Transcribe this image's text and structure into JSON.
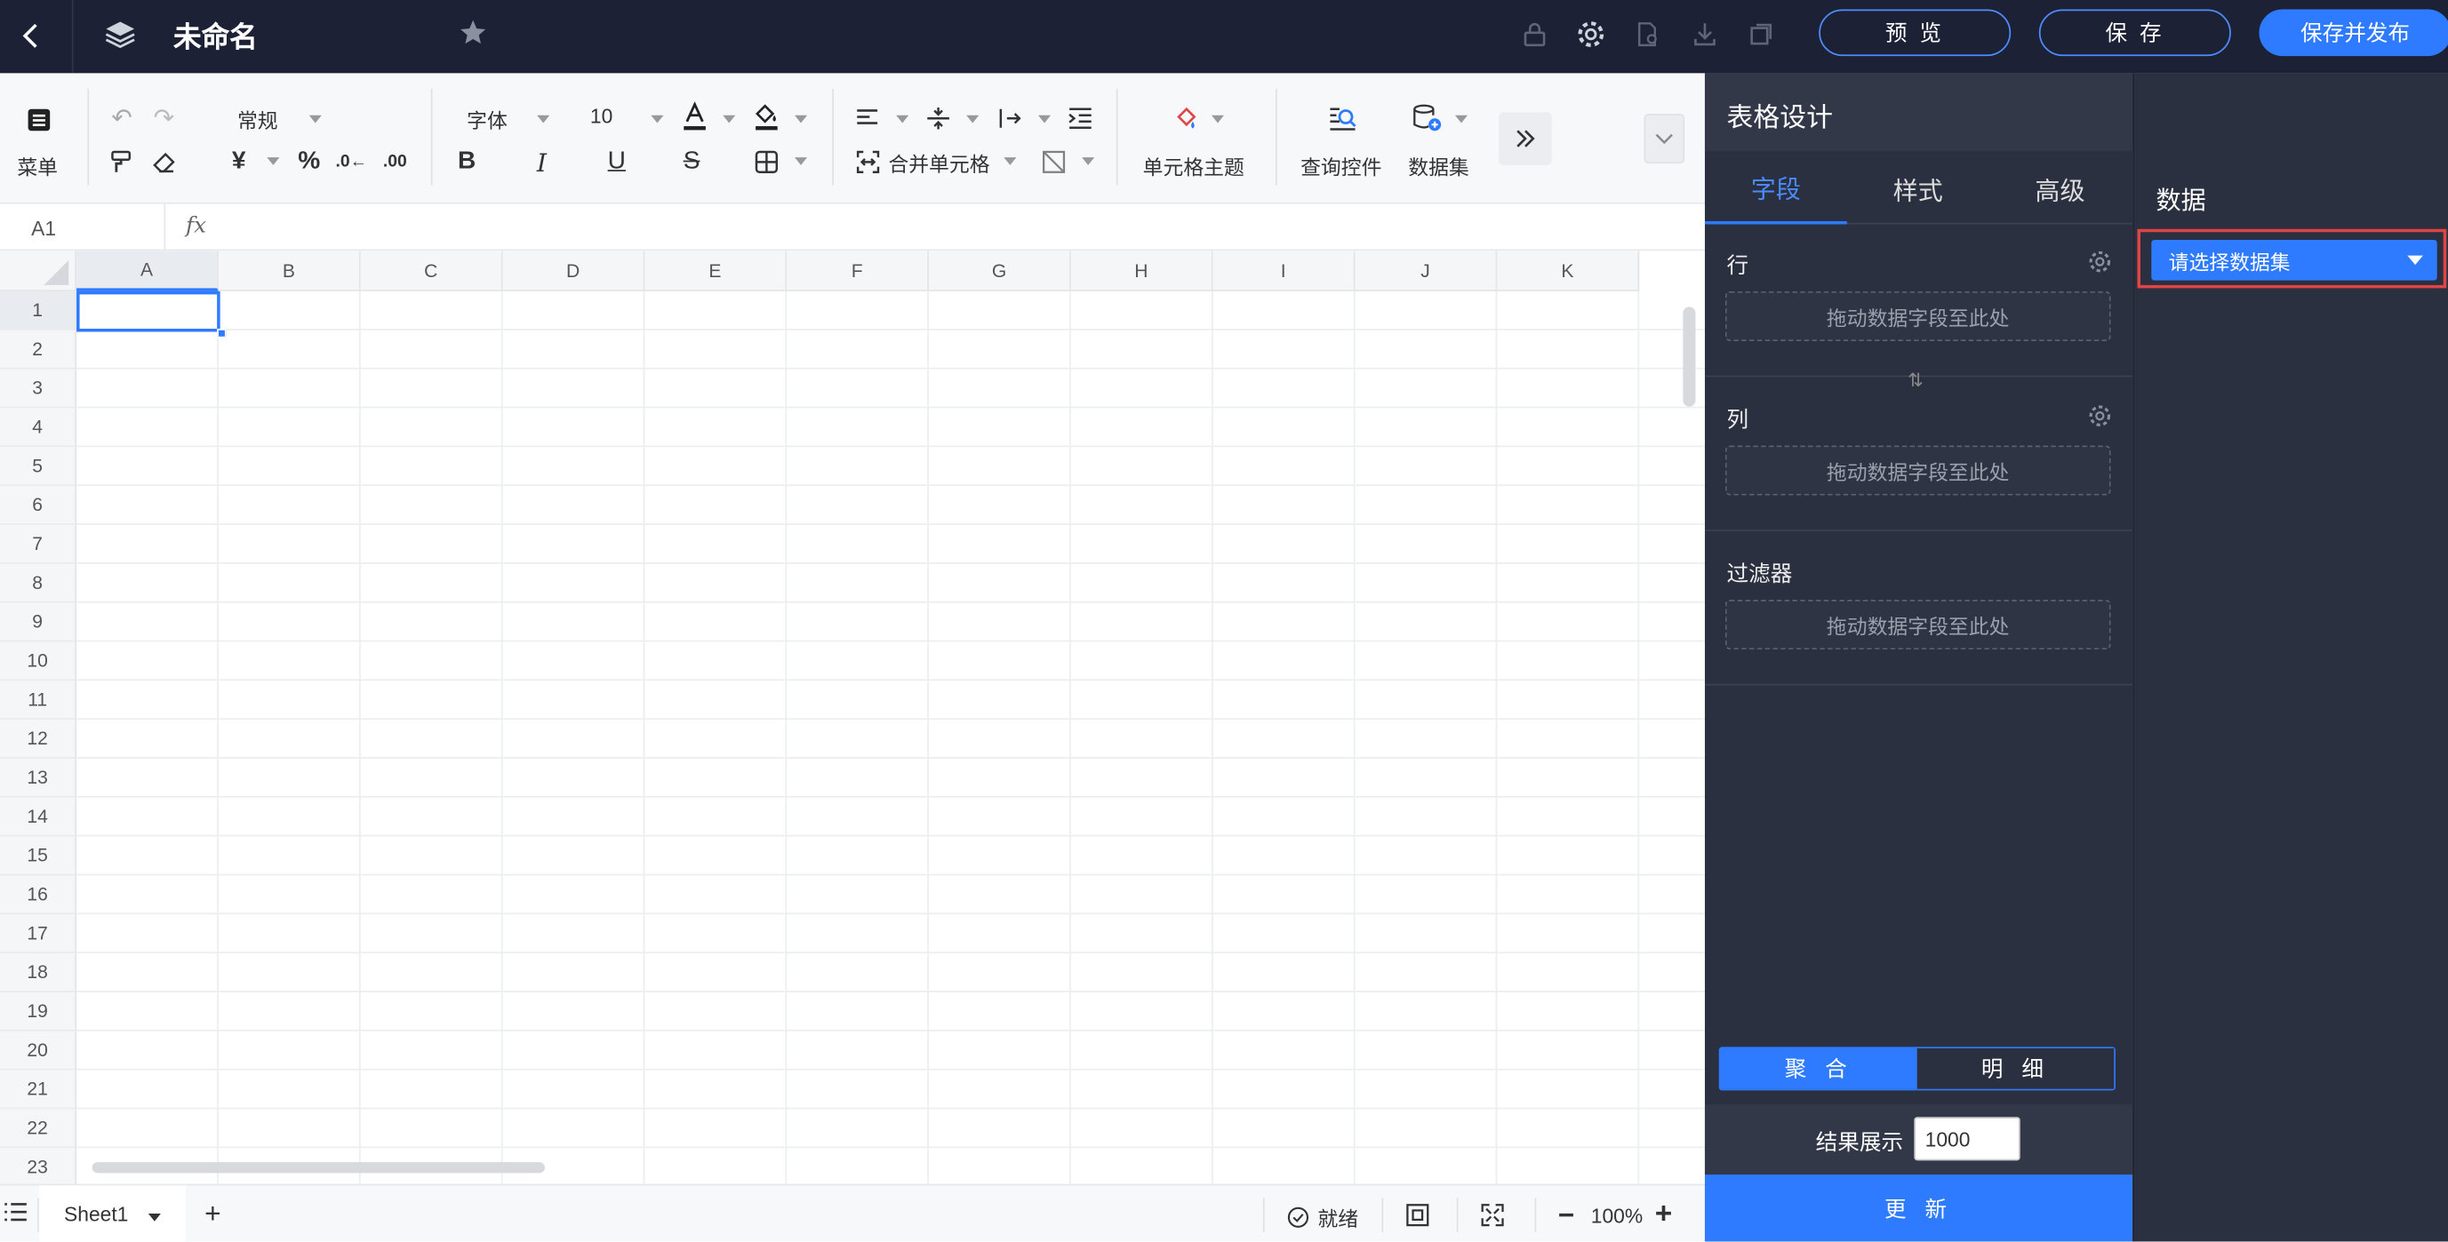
{
  "topbar": {
    "title": "未命名",
    "preview_label": "预 览",
    "save_label": "保 存",
    "save_publish_label": "保存并发布"
  },
  "toolbar": {
    "menu_label": "菜单",
    "number_format": "常规",
    "font_family": "字体",
    "font_size": "10",
    "merge_label": "合并单元格",
    "cell_theme_label": "单元格主题",
    "query_control_label": "查询控件",
    "dataset_label": "数据集"
  },
  "formula_bar": {
    "cell_ref": "A1",
    "fx_label": "fx"
  },
  "sheet": {
    "columns": [
      "A",
      "B",
      "C",
      "D",
      "E",
      "F",
      "G",
      "H",
      "I",
      "J",
      "K"
    ],
    "rows": [
      "1",
      "2",
      "3",
      "4",
      "5",
      "6",
      "7",
      "8",
      "9",
      "10",
      "11",
      "12",
      "13",
      "14",
      "15",
      "16",
      "17",
      "18",
      "19",
      "20",
      "21",
      "22",
      "23"
    ]
  },
  "status_bar": {
    "sheet_tab": "Sheet1",
    "add_label": "+",
    "status_text": "就绪",
    "zoom": "100%"
  },
  "design_panel": {
    "title": "表格设计",
    "tabs": [
      "字段",
      "样式",
      "高级"
    ],
    "rows_label": "行",
    "cols_label": "列",
    "filter_label": "过滤器",
    "drop_hint": "拖动数据字段至此处",
    "swap_icon": "⇅",
    "mode_aggregate": "聚 合",
    "mode_detail": "明 细",
    "result_label": "结果展示",
    "result_value": "1000",
    "update_label": "更 新"
  },
  "data_panel": {
    "title": "数据",
    "dataset_placeholder": "请选择数据集"
  },
  "colors": {
    "topbar_bg": "#1c2135",
    "accent": "#2f7bff",
    "panel_bg": "#2b3040",
    "highlight_border": "#e04545"
  }
}
